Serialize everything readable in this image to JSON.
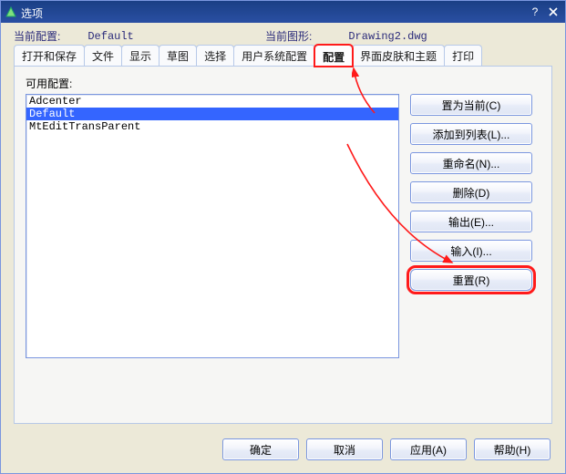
{
  "window": {
    "title": "选项"
  },
  "header": {
    "current_config_label": "当前配置:",
    "current_config_value": "Default",
    "current_drawing_label": "当前图形:",
    "current_drawing_value": "Drawing2.dwg"
  },
  "tabs": [
    {
      "label": "打开和保存"
    },
    {
      "label": "文件"
    },
    {
      "label": "显示"
    },
    {
      "label": "草图"
    },
    {
      "label": "选择"
    },
    {
      "label": "用户系统配置"
    },
    {
      "label": "配置"
    },
    {
      "label": "界面皮肤和主题"
    },
    {
      "label": "打印"
    }
  ],
  "panel": {
    "available_label": "可用配置:",
    "items": [
      {
        "name": "Adcenter",
        "selected": false
      },
      {
        "name": "Default",
        "selected": true
      },
      {
        "name": "MtEditTransParent",
        "selected": false
      }
    ],
    "buttons": {
      "set_current": "置为当前(C)",
      "add_to_list": "添加到列表(L)...",
      "rename": "重命名(N)...",
      "delete": "删除(D)",
      "export": "输出(E)...",
      "import": "输入(I)...",
      "reset": "重置(R)"
    }
  },
  "dialog_buttons": {
    "ok": "确定",
    "cancel": "取消",
    "apply": "应用(A)",
    "help": "帮助(H)"
  }
}
